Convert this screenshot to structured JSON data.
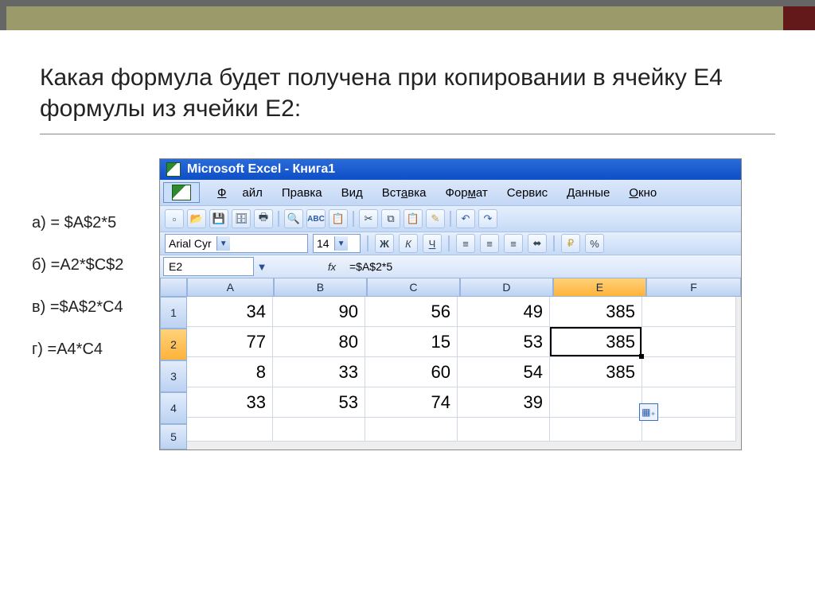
{
  "question": "Какая формула будет получена при копировании в ячейку Е4 формулы из ячейки Е2:",
  "options": {
    "a": "а) = $A$2*5",
    "b": "б) =A2*$C$2",
    "c": "в) =$A$2*C4",
    "d": "г) =A4*C4"
  },
  "excel": {
    "title": "Microsoft Excel - Книга1",
    "menu": {
      "file": "Файл",
      "edit": "Правка",
      "view": "Вид",
      "insert": "Вставка",
      "format": "Формат",
      "tools": "Сервис",
      "data": "Данные",
      "window": "Окно"
    },
    "font": {
      "name": "Arial Cyr",
      "size": "14"
    },
    "toolbar2": {
      "bold": "Ж",
      "italic": "К",
      "underline": "Ч",
      "percent": "%"
    },
    "name_box": "E2",
    "formula": "=$A$2*5",
    "fx": "fx",
    "columns": [
      "A",
      "B",
      "C",
      "D",
      "E",
      "F"
    ],
    "rows": [
      "1",
      "2",
      "3",
      "4",
      "5"
    ],
    "cells": {
      "r1": {
        "A": "34",
        "B": "90",
        "C": "56",
        "D": "49",
        "E": "385",
        "F": ""
      },
      "r2": {
        "A": "77",
        "B": "80",
        "C": "15",
        "D": "53",
        "E": "385",
        "F": ""
      },
      "r3": {
        "A": "8",
        "B": "33",
        "C": "60",
        "D": "54",
        "E": "385",
        "F": ""
      },
      "r4": {
        "A": "33",
        "B": "53",
        "C": "74",
        "D": "39",
        "E": "",
        "F": ""
      },
      "r5": {
        "A": "",
        "B": "",
        "C": "",
        "D": "",
        "E": "",
        "F": ""
      }
    },
    "selected_col": "E",
    "selected_row": "2"
  }
}
